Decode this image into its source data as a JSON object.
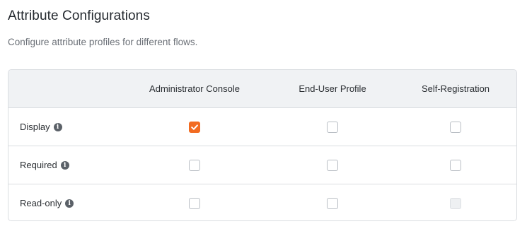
{
  "page": {
    "title": "Attribute Configurations",
    "subtitle": "Configure attribute profiles for different flows."
  },
  "table": {
    "columns": [
      "Administrator Console",
      "End-User Profile",
      "Self-Registration"
    ],
    "rows": [
      {
        "label": "Display",
        "info_icon": "info-icon",
        "checks": [
          true,
          false,
          false
        ],
        "disabled": [
          false,
          false,
          false
        ]
      },
      {
        "label": "Required",
        "info_icon": "info-icon",
        "checks": [
          false,
          false,
          false
        ],
        "disabled": [
          false,
          false,
          false
        ]
      },
      {
        "label": "Read-only",
        "info_icon": "info-icon",
        "checks": [
          false,
          false,
          false
        ],
        "disabled": [
          false,
          false,
          true
        ]
      }
    ]
  },
  "colors": {
    "accent": "#f26b21",
    "header_bg": "#f0f2f4",
    "border": "#dadde1"
  }
}
